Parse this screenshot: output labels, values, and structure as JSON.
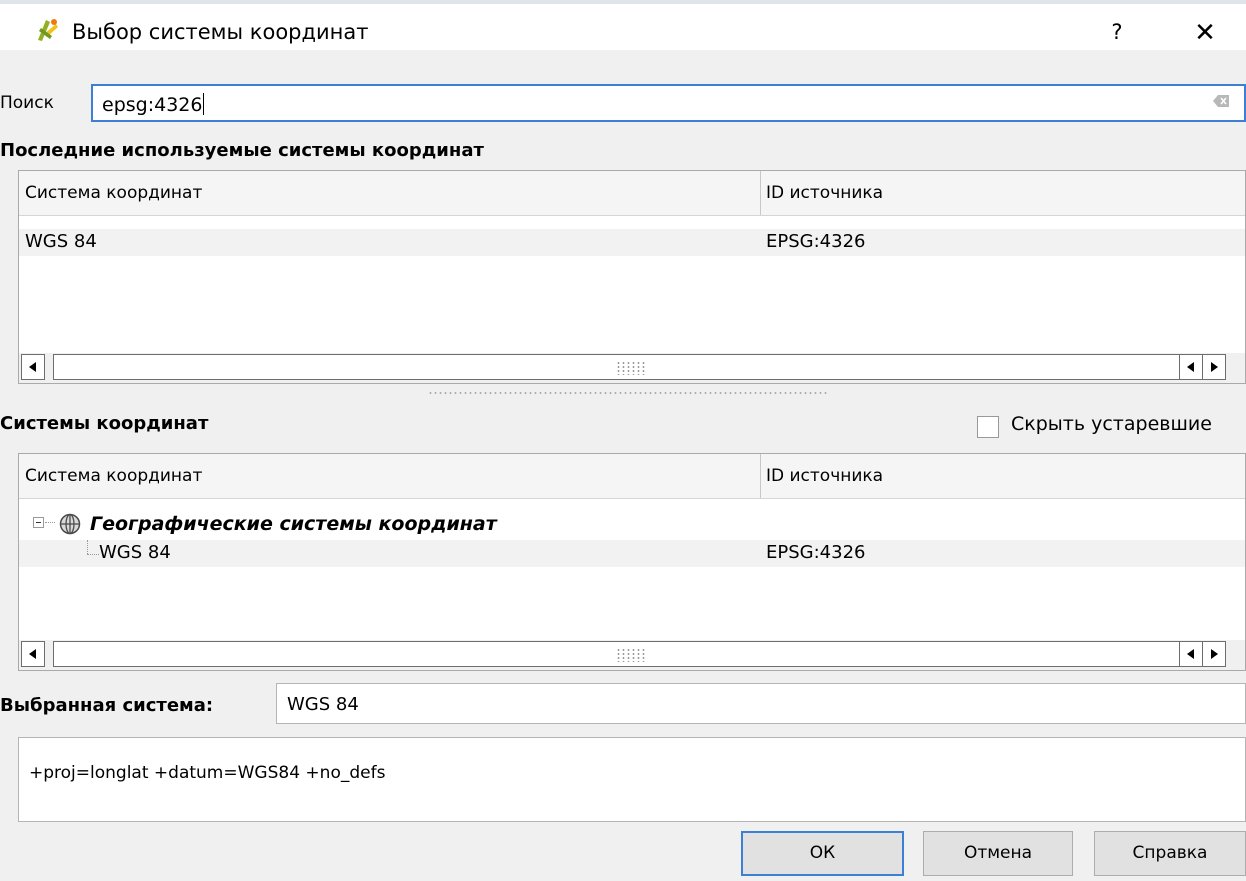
{
  "window": {
    "title": "Выбор системы координат",
    "help_label": "?",
    "close_label": "✕"
  },
  "search": {
    "label": "Поиск",
    "value": "epsg:4326"
  },
  "recent": {
    "title": "Последние используемые системы координат",
    "columns": [
      "Система координат",
      "ID источника"
    ],
    "rows": [
      {
        "name": "WGS 84",
        "id": "EPSG:4326"
      }
    ]
  },
  "systems": {
    "title": "Системы координат",
    "hide_deprecated_label": "Скрыть устаревшие",
    "hide_deprecated_checked": false,
    "columns": [
      "Система координат",
      "ID источника"
    ],
    "group": {
      "name": "Географические системы координат",
      "icon": "globe-icon",
      "expanded": true
    },
    "rows": [
      {
        "name": "WGS 84",
        "id": "EPSG:4326"
      }
    ]
  },
  "selected": {
    "label": "Выбранная система:",
    "value": "WGS 84",
    "proj": "+proj=longlat +datum=WGS84 +no_defs"
  },
  "buttons": {
    "ok": "ОК",
    "cancel": "Отмена",
    "help": "Справка"
  },
  "colors": {
    "focus_border": "#3c7fd5",
    "window_bg": "#f0f0f0",
    "row_bg": "#f2f2f2"
  }
}
